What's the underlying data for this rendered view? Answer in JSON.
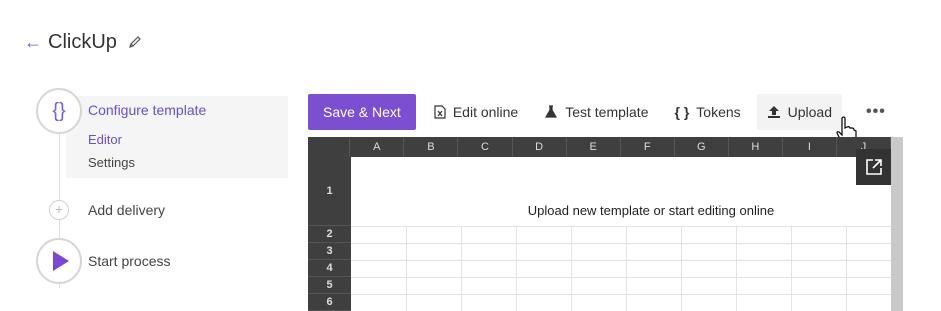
{
  "header": {
    "title": "ClickUp",
    "back_icon": "arrow-left-icon",
    "edit_icon": "pencil-icon"
  },
  "steps": {
    "configure": {
      "label": "Configure template",
      "icon_text": "{}",
      "sub_items": [
        "Editor",
        "Settings"
      ]
    },
    "delivery": {
      "label": "Add delivery",
      "icon_text": "+"
    },
    "process": {
      "label": "Start process"
    }
  },
  "toolbar": {
    "save_next": "Save & Next",
    "edit_online": "Edit online",
    "test_template": "Test template",
    "tokens": "Tokens",
    "tokens_icon_text": "{ }",
    "upload": "Upload",
    "more": "•••"
  },
  "sheet": {
    "columns": [
      "A",
      "B",
      "C",
      "D",
      "E",
      "F",
      "G",
      "H",
      "I",
      "J"
    ],
    "rows": [
      "1",
      "2",
      "3",
      "4",
      "5",
      "6"
    ],
    "message": "Upload new template or start editing online"
  },
  "colors": {
    "accent": "#7b4fd0",
    "sheet_header": "#3f3f3f"
  }
}
